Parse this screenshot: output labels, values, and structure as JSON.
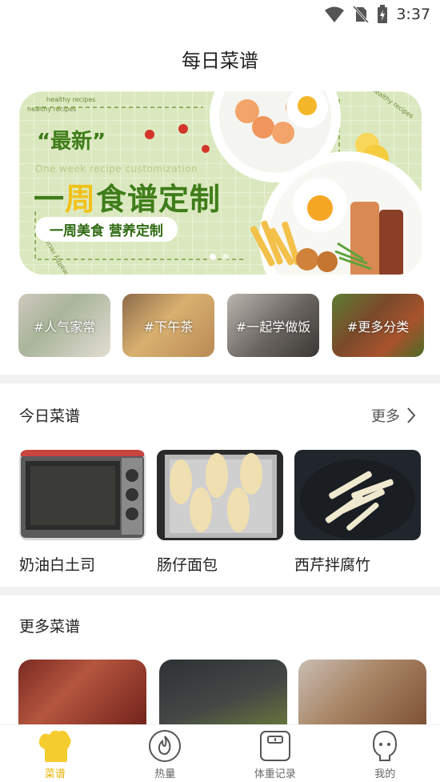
{
  "status_bar": {
    "time": "3:37"
  },
  "app": {
    "title": "每日菜谱"
  },
  "banner": {
    "tag_text": "healthy recipes",
    "latest": "“最新”",
    "subtitle_en": "One week recipe customization",
    "headline_part1": "一",
    "headline_highlight": "周",
    "headline_part2": "食谱定制",
    "pill": "一周美食 营养定制",
    "slides": 2,
    "active_slide": 1
  },
  "categories": [
    {
      "label": "#人气家常"
    },
    {
      "label": "#下午茶"
    },
    {
      "label": "#一起学做饭"
    },
    {
      "label": "#更多分类"
    }
  ],
  "today": {
    "title": "今日菜谱",
    "more": "更多",
    "recipes": [
      {
        "name": "奶油白土司"
      },
      {
        "name": "肠仔面包"
      },
      {
        "name": "西芹拌腐竹"
      }
    ]
  },
  "more_recipes": {
    "title": "更多菜谱"
  },
  "tabbar": {
    "tabs": [
      {
        "label": "菜谱",
        "icon": "chef-hat-icon",
        "active": true
      },
      {
        "label": "热量",
        "icon": "flame-icon",
        "active": false
      },
      {
        "label": "体重记录",
        "icon": "scale-icon",
        "active": false
      },
      {
        "label": "我的",
        "icon": "profile-icon",
        "active": false
      }
    ]
  },
  "colors": {
    "accent": "#e8b400",
    "banner_green": "#3f7d1a",
    "banner_bg": "#dbe8bf"
  }
}
